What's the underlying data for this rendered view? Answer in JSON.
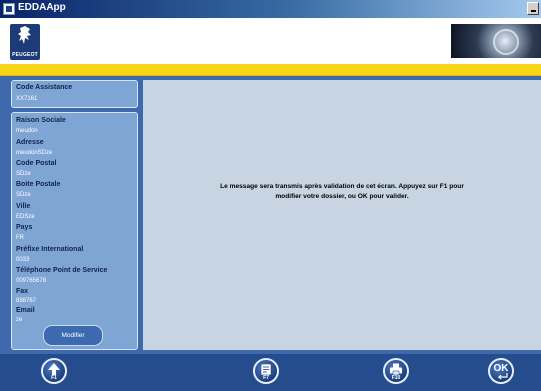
{
  "window": {
    "title": "EDDAApp"
  },
  "header": {
    "brand": "PEUGEOT"
  },
  "left_panel": {
    "code_assistance": {
      "label": "Code Assistance",
      "value": "XX7161"
    },
    "fields": [
      {
        "label": "Raison Sociale",
        "value": "meudon"
      },
      {
        "label": "Adresse",
        "value": "meudonSDze"
      },
      {
        "label": "Code Postal",
        "value": "SDze"
      },
      {
        "label": "Boite Postale",
        "value": "SDze"
      },
      {
        "label": "Ville",
        "value": "EDSze"
      },
      {
        "label": "Pays",
        "value": "FR"
      },
      {
        "label": "Préfixe International",
        "value": "0033"
      },
      {
        "label": "Téléphone Point de Service",
        "value": "009765678"
      },
      {
        "label": "Fax",
        "value": "898767"
      },
      {
        "label": "Email",
        "value": "ze"
      }
    ],
    "modify_button": "Modifier"
  },
  "message": {
    "line1": "Le message sera transmis après validation de cet écran. Appuyez sur F1 pour",
    "line2": "modifier votre dossier, ou OK pour valider."
  },
  "footer": {
    "buttons": [
      {
        "key": "F1",
        "icon": "arrow-up-icon"
      },
      {
        "key": "F7",
        "icon": "document-icon"
      },
      {
        "key": "F10",
        "icon": "print-icon"
      },
      {
        "key": "OK",
        "icon": "ok-icon"
      }
    ]
  },
  "colors": {
    "accent_yellow": "#f7d417",
    "panel_blue": "#7fa5d4",
    "main_blue": "#3e69ac",
    "footer_blue": "#254d8e",
    "message_bg": "#c7d5e2"
  }
}
